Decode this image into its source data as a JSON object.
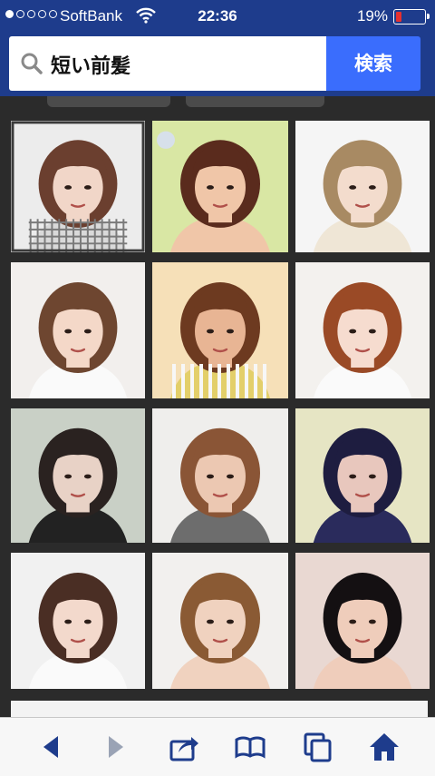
{
  "status_bar": {
    "carrier": "SoftBank",
    "time": "22:36",
    "battery_percent": "19%",
    "battery_level": 0.19,
    "signal_dots_filled": 1,
    "signal_dots_total": 5
  },
  "search": {
    "query": "短い前髪",
    "button_label": "検索",
    "accent_color": "#3a6dfd",
    "header_color": "#1e3c8c"
  },
  "results": [
    {
      "name": "result-image-1",
      "hair": "#6b3f2f",
      "bg": "#ececec",
      "skin": "#f1d6c8",
      "shirt": "gingham"
    },
    {
      "name": "result-image-2",
      "hair": "#5a2b1d",
      "bg": "#d9e7a4",
      "skin": "#f0c6a8",
      "shirt": "none"
    },
    {
      "name": "result-image-3",
      "hair": "#a88a63",
      "bg": "#f5f5f5",
      "skin": "#f3dccd",
      "shirt": "cream"
    },
    {
      "name": "result-image-4",
      "hair": "#6e4630",
      "bg": "#f2efed",
      "skin": "#f4d8c8",
      "shirt": "white"
    },
    {
      "name": "result-image-5",
      "hair": "#6d3a20",
      "bg": "#f6e0b8",
      "skin": "#e8b594",
      "shirt": "stripe"
    },
    {
      "name": "result-image-6",
      "hair": "#9a4a26",
      "bg": "#f3f1ee",
      "skin": "#f6dccf",
      "shirt": "white"
    },
    {
      "name": "result-image-7",
      "hair": "#2a2220",
      "bg": "#c9d0c6",
      "skin": "#e8d2c6",
      "shirt": "dark"
    },
    {
      "name": "result-image-8",
      "hair": "#8a5536",
      "bg": "#efeeec",
      "skin": "#ecc8b2",
      "shirt": "grey"
    },
    {
      "name": "result-image-9",
      "hair": "#1e1d40",
      "bg": "#e6e5c4",
      "skin": "#e8c7bd",
      "shirt": "navy"
    },
    {
      "name": "result-image-10",
      "hair": "#4a2e24",
      "bg": "#f1f1f1",
      "skin": "#f3d9cc",
      "shirt": "white"
    },
    {
      "name": "result-image-11",
      "hair": "#8a5a34",
      "bg": "#f2f0ee",
      "skin": "#f0d2bf",
      "shirt": "none"
    },
    {
      "name": "result-image-12",
      "hair": "#141012",
      "bg": "#e9d8d2",
      "skin": "#efcdbb",
      "shirt": "none"
    }
  ],
  "toolbar": {
    "icon_color": "#1e3c8c",
    "disabled_color": "#9aa3b5",
    "items": [
      "back-icon",
      "forward-icon",
      "share-icon",
      "bookmarks-icon",
      "tabs-icon",
      "home-icon"
    ]
  }
}
